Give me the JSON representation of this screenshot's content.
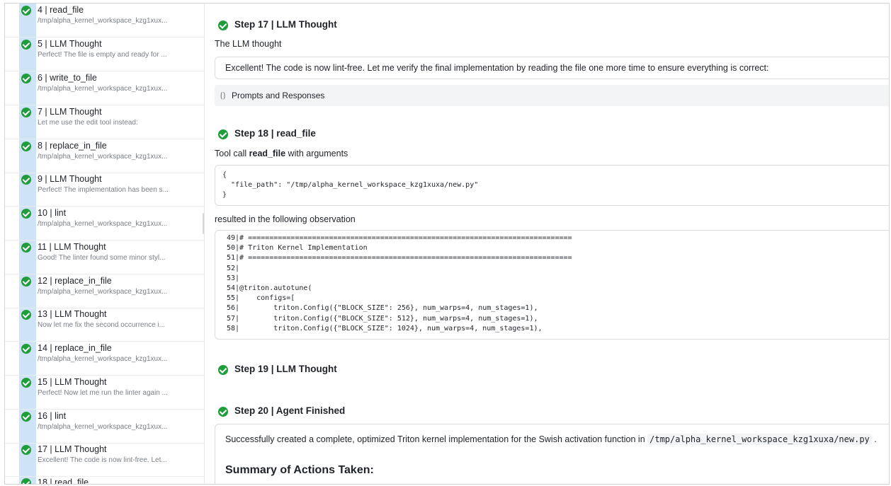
{
  "sidebar": {
    "items": [
      {
        "title": "4 | read_file",
        "sub": "/tmp/alpha_kernel_workspace_kzg1xux..."
      },
      {
        "title": "5 | LLM Thought",
        "sub": "Perfect! The file is empty and ready for ..."
      },
      {
        "title": "6 | write_to_file",
        "sub": "/tmp/alpha_kernel_workspace_kzg1xux..."
      },
      {
        "title": "7 | LLM Thought",
        "sub": "Let me use the edit tool instead:"
      },
      {
        "title": "8 | replace_in_file",
        "sub": "/tmp/alpha_kernel_workspace_kzg1xux..."
      },
      {
        "title": "9 | LLM Thought",
        "sub": "Perfect! The implementation has been s..."
      },
      {
        "title": "10 | lint",
        "sub": "/tmp/alpha_kernel_workspace_kzg1xux..."
      },
      {
        "title": "11 | LLM Thought",
        "sub": "Good! The linter found some minor styl..."
      },
      {
        "title": "12 | replace_in_file",
        "sub": "/tmp/alpha_kernel_workspace_kzg1xux..."
      },
      {
        "title": "13 | LLM Thought",
        "sub": "Now let me fix the second occurrence i..."
      },
      {
        "title": "14 | replace_in_file",
        "sub": "/tmp/alpha_kernel_workspace_kzg1xux..."
      },
      {
        "title": "15 | LLM Thought",
        "sub": "Perfect! Now let me run the linter again ..."
      },
      {
        "title": "16 | lint",
        "sub": "/tmp/alpha_kernel_workspace_kzg1xux..."
      },
      {
        "title": "17 | LLM Thought",
        "sub": "Excellent! The code is now lint-free. Let..."
      },
      {
        "title": "18 | read_file",
        "sub": ""
      }
    ]
  },
  "steps": {
    "s17": {
      "title": "Step 17 | LLM Thought",
      "label": "The LLM thought",
      "thought": "Excellent! The code is now lint-free. Let me verify the final implementation by reading the file one more time to ensure everything is correct:",
      "prompts_label": "Prompts and Responses"
    },
    "s18": {
      "title": "Step 18 | read_file",
      "call_prefix": "Tool call ",
      "call_tool": "read_file",
      "call_suffix": " with arguments",
      "args": "{\n  \"file_path\": \"/tmp/alpha_kernel_workspace_kzg1xuxa/new.py\"\n}",
      "obs_label": "resulted in the following observation",
      "observation": "49|# ============================================================================\n50|# Triton Kernel Implementation\n51|# ============================================================================\n52|\n53|\n54|@triton.autotune(\n55|    configs=[\n56|        triton.Config({\"BLOCK_SIZE\": 256}, num_warps=4, num_stages=1),\n57|        triton.Config({\"BLOCK_SIZE\": 512}, num_warps=4, num_stages=1),\n58|        triton.Config({\"BLOCK_SIZE\": 1024}, num_warps=4, num_stages=1),"
    },
    "s19": {
      "title": "Step 19 | LLM Thought"
    },
    "s20": {
      "title": "Step 20 | Agent Finished",
      "text_before": "Successfully created a complete, optimized Triton kernel implementation for the Swish activation function in ",
      "path": "/tmp/alpha_kernel_workspace_kzg1xuxa/new.py",
      "text_after": " .",
      "summary_heading": "Summary of Actions Taken:"
    }
  },
  "colors": {
    "success": "#1f9d3a",
    "rail": "#cfe3f7"
  }
}
